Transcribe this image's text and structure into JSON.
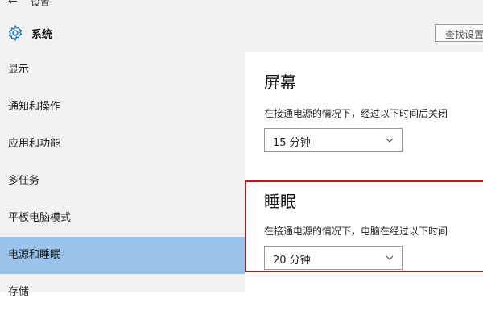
{
  "titlebar": {
    "back": "←",
    "title": "设置"
  },
  "header": {
    "title": "系统",
    "search_placeholder": "查找设置"
  },
  "sidebar": {
    "items": [
      {
        "label": "显示"
      },
      {
        "label": "通知和操作"
      },
      {
        "label": "应用和功能"
      },
      {
        "label": "多任务"
      },
      {
        "label": "平板电脑模式"
      },
      {
        "label": "电源和睡眠",
        "selected": true
      },
      {
        "label": "存储"
      }
    ]
  },
  "screen": {
    "title": "屏幕",
    "description": "在接通电源的情况下，经过以下时间后关闭",
    "value": "15 分钟"
  },
  "sleep": {
    "title": "睡眠",
    "description": "在接通电源的情况下，电脑在经过以下时间",
    "value": "20 分钟"
  },
  "colors": {
    "selected": "#99c3ea",
    "highlight": "#c0161c",
    "accent": "#1e73be"
  },
  "icons": {
    "back": "back-arrow-icon",
    "settings": "gear-icon",
    "dropdown": "chevron-down-icon"
  }
}
